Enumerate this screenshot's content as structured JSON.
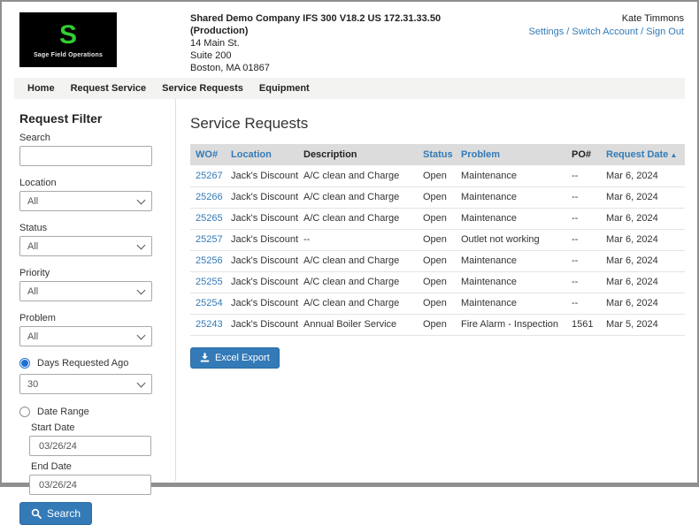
{
  "colors": {
    "accent_blue": "#337ab7",
    "button_border": "#2e6da4",
    "logo_green": "#33cc33",
    "table_header_bg": "#dcdcdc",
    "nav_bg": "#f3f3f1",
    "page_border": "#8f8f8f"
  },
  "header": {
    "logo": {
      "letter": "S",
      "caption": "Sage Field Operations"
    },
    "company": {
      "line1": "Shared Demo Company IFS 300 V18.2 US 172.31.33.50",
      "line2": "(Production)",
      "address1": "14 Main St.",
      "address2": "Suite 200",
      "address3": "Boston, MA 01867"
    },
    "user": {
      "name": "Kate Timmons",
      "links": [
        "Settings",
        "Switch Account",
        "Sign Out"
      ],
      "separator": " / "
    }
  },
  "nav": {
    "items": [
      "Home",
      "Request Service",
      "Service Requests",
      "Equipment"
    ]
  },
  "sidebar": {
    "title": "Request Filter",
    "search": {
      "label": "Search",
      "value": ""
    },
    "selects": [
      {
        "label": "Location",
        "value": "All"
      },
      {
        "label": "Status",
        "value": "All"
      },
      {
        "label": "Priority",
        "value": "All"
      },
      {
        "label": "Problem",
        "value": "All"
      }
    ],
    "days_radio": {
      "label": "Days Requested Ago",
      "selected": true,
      "value": "30"
    },
    "range_radio": {
      "label": "Date Range",
      "selected": false
    },
    "start_date": {
      "label": "Start Date",
      "value": "03/26/24"
    },
    "end_date": {
      "label": "End Date",
      "value": "03/26/24"
    },
    "search_button": "Search"
  },
  "main": {
    "title": "Service Requests",
    "table": {
      "columns": [
        {
          "label": "WO#",
          "sortable": true
        },
        {
          "label": "Location",
          "sortable": true
        },
        {
          "label": "Description",
          "sortable": false
        },
        {
          "label": "Status",
          "sortable": true
        },
        {
          "label": "Problem",
          "sortable": true
        },
        {
          "label": "PO#",
          "sortable": false
        },
        {
          "label": "Request Date",
          "sortable": true,
          "sorted": "asc"
        }
      ],
      "sort_arrow": "▲",
      "rows": [
        [
          "25267",
          "Jack's Discount",
          "A/C clean and Charge",
          "Open",
          "Maintenance",
          "--",
          "Mar 6, 2024"
        ],
        [
          "25266",
          "Jack's Discount",
          "A/C clean and Charge",
          "Open",
          "Maintenance",
          "--",
          "Mar 6, 2024"
        ],
        [
          "25265",
          "Jack's Discount",
          "A/C clean and Charge",
          "Open",
          "Maintenance",
          "--",
          "Mar 6, 2024"
        ],
        [
          "25257",
          "Jack's Discount",
          "--",
          "Open",
          "Outlet not working",
          "--",
          "Mar 6, 2024"
        ],
        [
          "25256",
          "Jack's Discount",
          "A/C clean and Charge",
          "Open",
          "Maintenance",
          "--",
          "Mar 6, 2024"
        ],
        [
          "25255",
          "Jack's Discount",
          "A/C clean and Charge",
          "Open",
          "Maintenance",
          "--",
          "Mar 6, 2024"
        ],
        [
          "25254",
          "Jack's Discount",
          "A/C clean and Charge",
          "Open",
          "Maintenance",
          "--",
          "Mar 6, 2024"
        ],
        [
          "25243",
          "Jack's Discount",
          "Annual Boiler Service",
          "Open",
          "Fire Alarm - Inspection",
          "1561",
          "Mar 5, 2024"
        ]
      ]
    },
    "export_button": "Excel Export"
  }
}
